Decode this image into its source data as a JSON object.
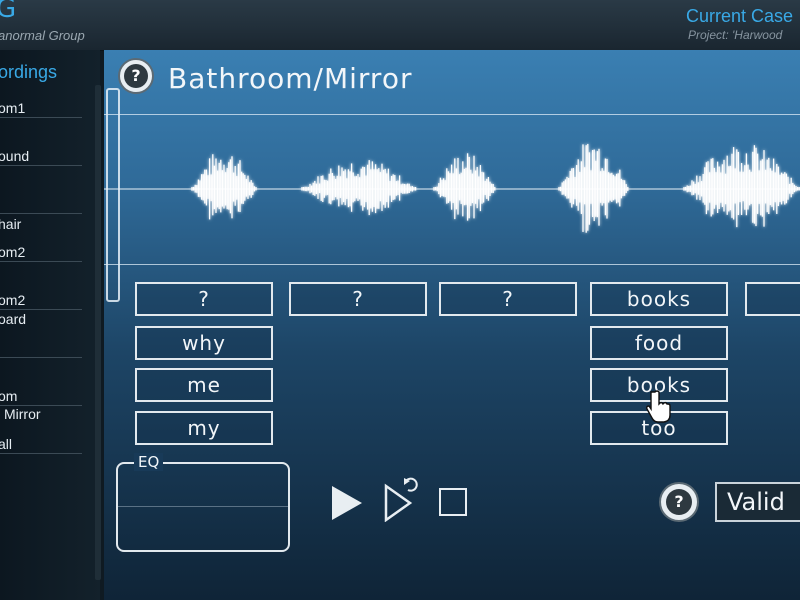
{
  "header": {
    "logo_letter": "G",
    "logo_subtitle": "anormal Group",
    "case_title": "Current Case",
    "project": "Project: 'Harwood"
  },
  "sidebar": {
    "title": "ordings",
    "items": [
      {
        "label": "om1"
      },
      {
        "label": "ound"
      },
      {
        "label": "hair"
      },
      {
        "label": "om2"
      },
      {
        "label": "om2"
      },
      {
        "label": "oard"
      },
      {
        "label": "om"
      },
      {
        "label": "Mirror"
      },
      {
        "label": "all"
      }
    ]
  },
  "recording": {
    "title": "Bathroom/Mirror",
    "help_symbol": "?"
  },
  "word_grid": {
    "columns": [
      {
        "slot": "?",
        "options": [
          "why",
          "me",
          "my"
        ]
      },
      {
        "slot": "?",
        "options": []
      },
      {
        "slot": "?",
        "options": []
      },
      {
        "slot": "books",
        "options": [
          "food",
          "books",
          "too"
        ]
      },
      {
        "slot": "",
        "options": []
      }
    ]
  },
  "eq": {
    "label": "EQ"
  },
  "controls": {
    "play": "play-icon",
    "replay": "replay-icon",
    "stop": "stop-icon"
  },
  "validate": {
    "label": "Valid",
    "help_symbol": "?"
  },
  "colors": {
    "accent": "#39a9e6",
    "panel": "#2f6a98",
    "text": "#f2f6f9"
  }
}
